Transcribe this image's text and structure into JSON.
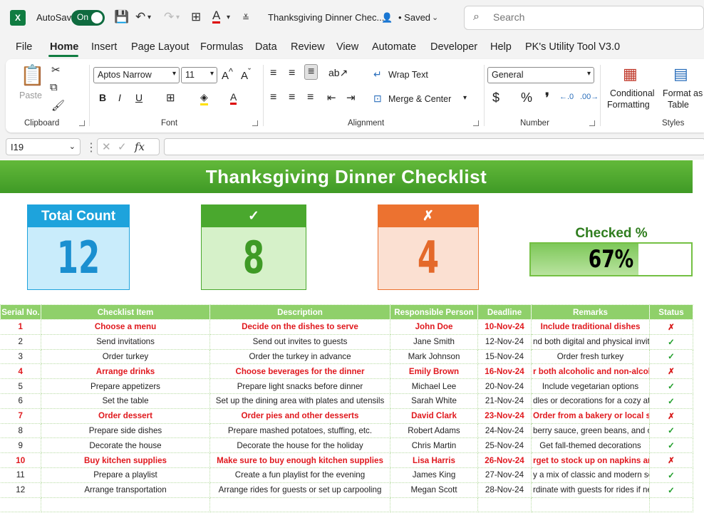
{
  "titlebar": {
    "app_icon": "excel-logo",
    "app_letter": "X",
    "autosave_label": "AutoSave",
    "autosave_state": "On",
    "doc_title": "Thanksgiving Dinner Chec...",
    "saved_status": "• Saved",
    "search_placeholder": "Search"
  },
  "menu": [
    "File",
    "Home",
    "Insert",
    "Page Layout",
    "Formulas",
    "Data",
    "Review",
    "View",
    "Automate",
    "Developer",
    "Help",
    "PK's Utility Tool V3.0"
  ],
  "ribbon": {
    "clipboard": {
      "label": "Clipboard",
      "paste": "Paste"
    },
    "font": {
      "label": "Font",
      "name": "Aptos Narrow",
      "size": "11"
    },
    "alignment": {
      "label": "Alignment",
      "wrap": "Wrap Text",
      "merge": "Merge & Center"
    },
    "number": {
      "label": "Number",
      "format": "General"
    },
    "styles": {
      "label": "Styles",
      "conditional": "Conditional",
      "conditional2": "Formatting",
      "format_as": "Format as",
      "format_as2": "Table"
    }
  },
  "formula_bar": {
    "name_box": "I19",
    "fx": "fx",
    "formula": ""
  },
  "sheet": {
    "title": "Thanksgiving Dinner Checklist",
    "cards": {
      "total": {
        "label": "Total Count",
        "value": "12",
        "color": "#1ea3dc"
      },
      "checked": {
        "label": "✓",
        "value": "8",
        "color": "#4aa82e"
      },
      "unchecked": {
        "label": "✗",
        "value": "4",
        "color": "#ec7230"
      }
    },
    "checked_pct": {
      "label": "Checked %",
      "value": "67%",
      "fraction": 0.67
    },
    "columns": [
      "Serial No.",
      "Checklist Item",
      "Description",
      "Responsible Person",
      "Deadline",
      "Remarks",
      "Status"
    ],
    "rows": [
      {
        "no": "1",
        "item": "Choose a menu",
        "desc": "Decide on the dishes to serve",
        "person": "John Doe",
        "deadline": "10-Nov-24",
        "remarks": "Include traditional dishes",
        "status": "✗"
      },
      {
        "no": "2",
        "item": "Send invitations",
        "desc": "Send out invites to guests",
        "person": "Jane Smith",
        "deadline": "12-Nov-24",
        "remarks": "nd both digital and physical invit",
        "status": "✓"
      },
      {
        "no": "3",
        "item": "Order turkey",
        "desc": "Order the turkey in advance",
        "person": "Mark Johnson",
        "deadline": "15-Nov-24",
        "remarks": "Order fresh turkey",
        "status": "✓"
      },
      {
        "no": "4",
        "item": "Arrange drinks",
        "desc": "Choose beverages for the dinner",
        "person": "Emily Brown",
        "deadline": "16-Nov-24",
        "remarks": "r both alcoholic and non-alcohol",
        "status": "✗"
      },
      {
        "no": "5",
        "item": "Prepare appetizers",
        "desc": "Prepare light snacks before dinner",
        "person": "Michael Lee",
        "deadline": "20-Nov-24",
        "remarks": "Include vegetarian options",
        "status": "✓"
      },
      {
        "no": "6",
        "item": "Set the table",
        "desc": "Set up the dining area with plates and utensils",
        "person": "Sarah White",
        "deadline": "21-Nov-24",
        "remarks": "dles or decorations for a cozy atm",
        "status": "✓"
      },
      {
        "no": "7",
        "item": "Order dessert",
        "desc": "Order pies and other desserts",
        "person": "David Clark",
        "deadline": "23-Nov-24",
        "remarks": "Order from a bakery or local shop",
        "status": "✗"
      },
      {
        "no": "8",
        "item": "Prepare side dishes",
        "desc": "Prepare mashed potatoes, stuffing, etc.",
        "person": "Robert Adams",
        "deadline": "24-Nov-24",
        "remarks": "berry sauce, green beans, and ot",
        "status": "✓"
      },
      {
        "no": "9",
        "item": "Decorate the house",
        "desc": "Decorate the house for the holiday",
        "person": "Chris Martin",
        "deadline": "25-Nov-24",
        "remarks": "Get fall-themed decorations",
        "status": "✓"
      },
      {
        "no": "10",
        "item": "Buy kitchen supplies",
        "desc": "Make sure to buy enough kitchen supplies",
        "person": "Lisa Harris",
        "deadline": "26-Nov-24",
        "remarks": "rget to stock up on napkins and",
        "status": "✗"
      },
      {
        "no": "11",
        "item": "Prepare a playlist",
        "desc": "Create a fun playlist for the evening",
        "person": "James King",
        "deadline": "27-Nov-24",
        "remarks": "y a mix of classic and modern so",
        "status": "✓"
      },
      {
        "no": "12",
        "item": "Arrange transportation",
        "desc": "Arrange rides for guests or set up carpooling",
        "person": "Megan Scott",
        "deadline": "28-Nov-24",
        "remarks": "rdinate with guests for rides if nee",
        "status": "✓"
      }
    ]
  }
}
